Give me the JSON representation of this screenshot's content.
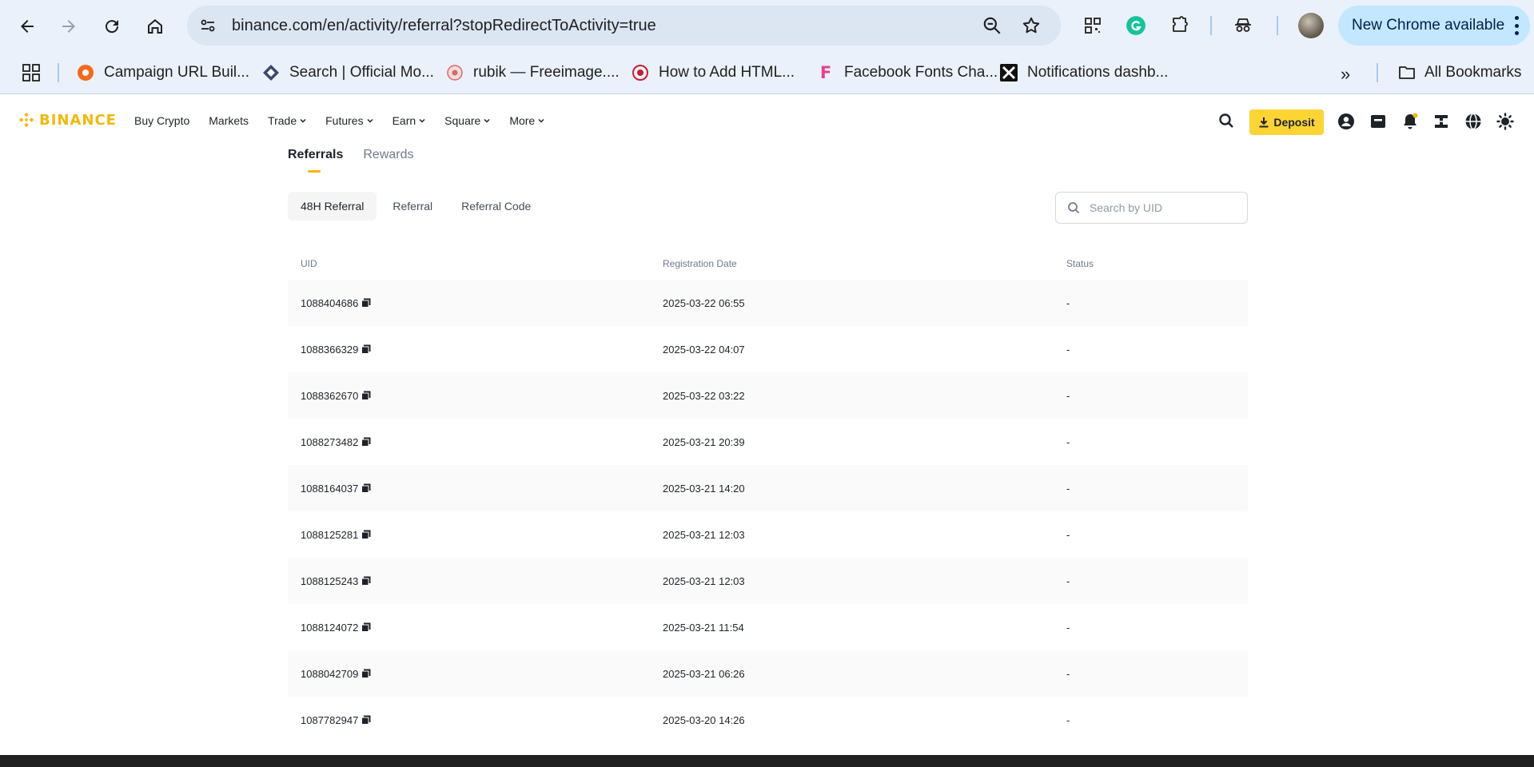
{
  "browser": {
    "url": "binance.com/en/activity/referral?stopRedirectToActivity=true",
    "update_button": "New Chrome available",
    "bookmarks": [
      {
        "label": "Campaign URL Buil...",
        "icon": "campaign-icon"
      },
      {
        "label": "Search | Official Mo...",
        "icon": "search-site-icon"
      },
      {
        "label": "rubik — Freeimage....",
        "icon": "freeimage-icon"
      },
      {
        "label": "How to Add HTML...",
        "icon": "html-site-icon"
      },
      {
        "label": "Facebook Fonts Cha...",
        "icon": "fonts-site-icon"
      },
      {
        "label": "Notifications dashb...",
        "icon": "notifications-site-icon"
      }
    ],
    "all_bookmarks": "All Bookmarks"
  },
  "header": {
    "logo": "BINANCE",
    "nav": [
      {
        "label": "Buy Crypto",
        "dropdown": false
      },
      {
        "label": "Markets",
        "dropdown": false
      },
      {
        "label": "Trade",
        "dropdown": true
      },
      {
        "label": "Futures",
        "dropdown": true
      },
      {
        "label": "Earn",
        "dropdown": true
      },
      {
        "label": "Square",
        "dropdown": true
      },
      {
        "label": "More",
        "dropdown": true
      }
    ],
    "deposit_label": "Deposit"
  },
  "tabs": [
    "Referrals",
    "Rewards"
  ],
  "subtabs": [
    "48H Referral",
    "Referral",
    "Referral Code"
  ],
  "search": {
    "placeholder": "Search by UID"
  },
  "table": {
    "columns": [
      "UID",
      "Registration Date",
      "Status"
    ],
    "rows": [
      {
        "uid": "1088404686",
        "date": "2025-03-22 06:55",
        "status": "-"
      },
      {
        "uid": "1088366329",
        "date": "2025-03-22 04:07",
        "status": "-"
      },
      {
        "uid": "1088362670",
        "date": "2025-03-22 03:22",
        "status": "-"
      },
      {
        "uid": "1088273482",
        "date": "2025-03-21 20:39",
        "status": "-"
      },
      {
        "uid": "1088164037",
        "date": "2025-03-21 14:20",
        "status": "-"
      },
      {
        "uid": "1088125281",
        "date": "2025-03-21 12:03",
        "status": "-"
      },
      {
        "uid": "1088125243",
        "date": "2025-03-21 12:03",
        "status": "-"
      },
      {
        "uid": "1088124072",
        "date": "2025-03-21 11:54",
        "status": "-"
      },
      {
        "uid": "1088042709",
        "date": "2025-03-21 06:26",
        "status": "-"
      },
      {
        "uid": "1087782947",
        "date": "2025-03-20 14:26",
        "status": "-"
      }
    ]
  },
  "colors": {
    "brand": "#f0b90b",
    "deposit_bg": "#fcd535",
    "chrome_bg": "#eaf1fb"
  }
}
